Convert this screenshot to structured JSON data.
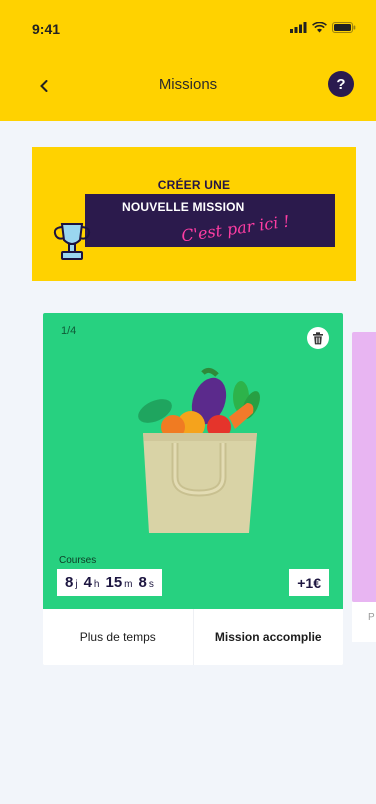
{
  "status_bar": {
    "time": "9:41"
  },
  "nav": {
    "title": "Missions",
    "help_label": "?"
  },
  "banner": {
    "line1": "CRÉER UNE",
    "line2": "NOUVELLE MISSION",
    "script": "C'est par ici !"
  },
  "mission": {
    "count": "1/4",
    "category": "Courses",
    "timer": {
      "days": "8",
      "days_unit": "j",
      "hours": "4",
      "hours_unit": "h",
      "minutes": "15",
      "minutes_unit": "m",
      "seconds": "8",
      "seconds_unit": "s"
    },
    "reward": "+1€",
    "more_time_label": "Plus de temps",
    "done_label": "Mission accomplie"
  },
  "next_card": {
    "footer_text": "P"
  },
  "colors": {
    "header": "#ffd200",
    "purple": "#2b1a4c",
    "card_green": "#27d180",
    "script_pink": "#ff3da3"
  }
}
